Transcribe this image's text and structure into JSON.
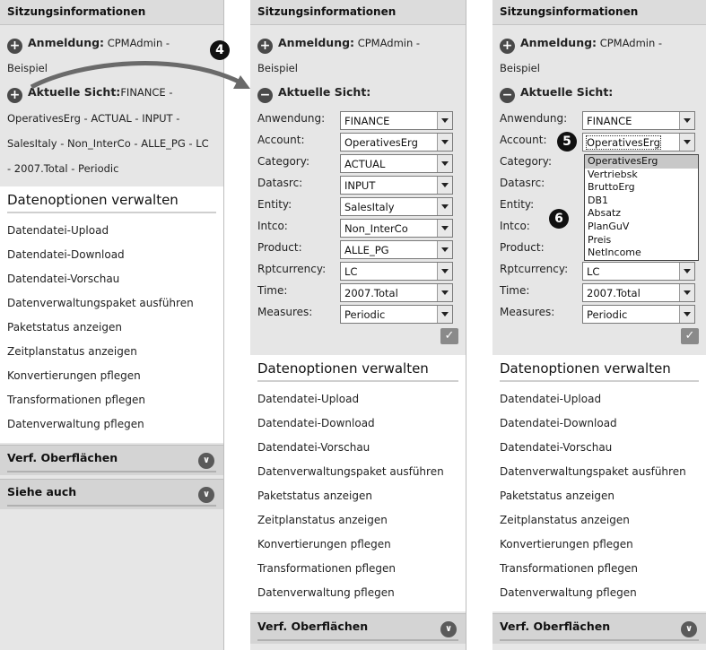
{
  "session_title": "Sitzungsinformationen",
  "login_label": "Anmeldung:",
  "login_value": "CPMAdmin -",
  "login_value_cont": "Beispiel",
  "current_view_label": "Aktuelle Sicht:",
  "panel1_current_view_value": "FINANCE -",
  "panel1_current_view_lines": [
    "OperativesErg - ACTUAL - INPUT -",
    "SalesItaly - Non_InterCo - ALLE_PG - LC",
    "- 2007.Total - Periodic"
  ],
  "manage_title": "Datenoptionen verwalten",
  "manage_links": [
    "Datendatei-Upload",
    "Datendatei-Download",
    "Datendatei-Vorschau",
    "Datenverwaltungspaket ausführen",
    "Paketstatus anzeigen",
    "Zeitplanstatus anzeigen",
    "Konvertierungen pflegen",
    "Transformationen pflegen",
    "Datenverwaltung pflegen"
  ],
  "section_surfaces": "Verf. Oberflächen",
  "section_see_also": "Siehe auch",
  "dimensions": [
    {
      "label": "Anwendung:",
      "value": "FINANCE"
    },
    {
      "label": "Account:",
      "value": "OperativesErg"
    },
    {
      "label": "Category:",
      "value": "ACTUAL"
    },
    {
      "label": "Datasrc:",
      "value": "INPUT"
    },
    {
      "label": "Entity:",
      "value": "SalesItaly"
    },
    {
      "label": "Intco:",
      "value": "Non_InterCo"
    },
    {
      "label": "Product:",
      "value": "ALLE_PG"
    },
    {
      "label": "Rptcurrency:",
      "value": "LC"
    },
    {
      "label": "Time:",
      "value": "2007.Total"
    },
    {
      "label": "Measures:",
      "value": "Periodic"
    }
  ],
  "account_options": [
    "OperativesErg",
    "Vertriebsk",
    "BruttoErg",
    "DB1",
    "Absatz",
    "PlanGuV",
    "Preis",
    "NetIncome"
  ],
  "callouts": {
    "c4": "4",
    "c5": "5",
    "c6": "6"
  },
  "icons": {
    "expand": "plus-circle-icon",
    "collapse": "minus-circle-icon",
    "chevron": "chevron-down-circle-icon",
    "ok": "checkmark-icon"
  },
  "colors": {
    "panel_bg": "#e6e6e6",
    "header_bg": "#dcdcdc",
    "callout": "#111111"
  }
}
